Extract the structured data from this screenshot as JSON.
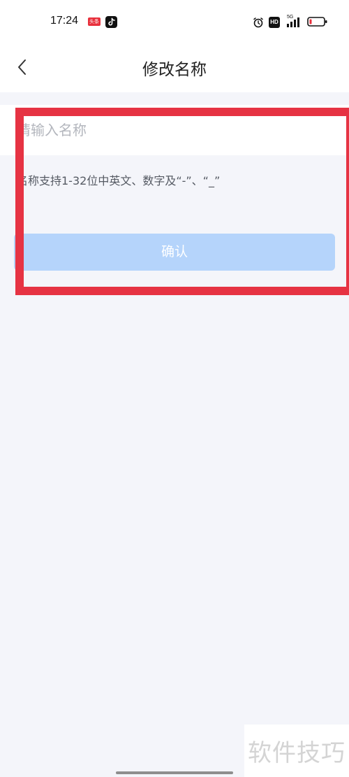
{
  "status_bar": {
    "time": "17:24",
    "news_badge": "头条",
    "hd_badge": "HD",
    "signal_label": "5G",
    "icons": [
      "tiktok-icon",
      "alarm-icon",
      "signal-icon",
      "battery-icon"
    ]
  },
  "nav": {
    "title": "修改名称",
    "back_icon": "chevron-left-icon"
  },
  "form": {
    "name_input": {
      "value": "",
      "placeholder": "请输入名称"
    },
    "hint": "名称支持1-32位中英文、数字及“-”、“_”",
    "confirm_label": "确认",
    "confirm_color": "#b5d4fb"
  },
  "annotation": {
    "highlight_color": "#e63343"
  },
  "watermark": {
    "text": "软件技巧"
  }
}
